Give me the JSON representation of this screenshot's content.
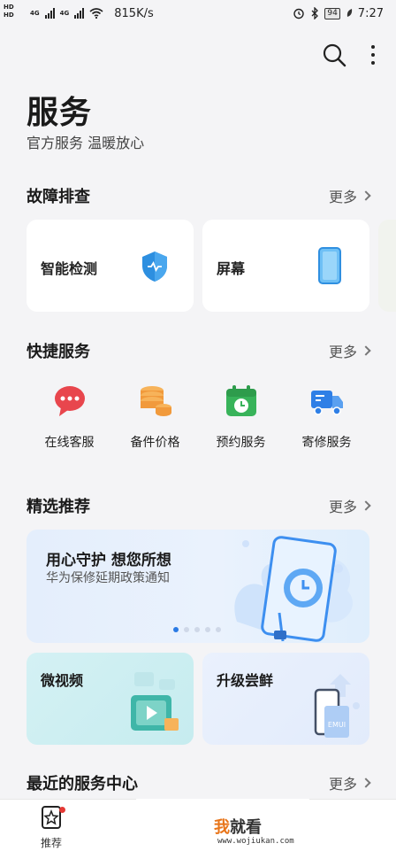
{
  "status_bar": {
    "hd_top": "HD",
    "hd_bottom": "HD",
    "net1": "4G",
    "net2": "4G",
    "speed": "815K/s",
    "battery": "94",
    "time": "7:27"
  },
  "header": {
    "title": "服务",
    "subtitle": "官方服务 温暖放心"
  },
  "sections": {
    "troubleshoot": {
      "title": "故障排查",
      "more": "更多"
    },
    "quick": {
      "title": "快捷服务",
      "more": "更多"
    },
    "featured": {
      "title": "精选推荐",
      "more": "更多"
    },
    "nearby": {
      "title": "最近的服务中心",
      "more": "更多"
    }
  },
  "troubleshoot_cards": [
    {
      "label": "智能检测",
      "icon": "shield-icon"
    },
    {
      "label": "屏幕",
      "icon": "phone-icon"
    }
  ],
  "quick_services": [
    {
      "label": "在线客服",
      "icon": "chat-bubble-icon"
    },
    {
      "label": "备件价格",
      "icon": "coins-icon"
    },
    {
      "label": "预约服务",
      "icon": "calendar-clock-icon"
    },
    {
      "label": "寄修服务",
      "icon": "truck-icon"
    }
  ],
  "banner": {
    "title": "用心守护 想您所想",
    "subtitle": "华为保修延期政策通知"
  },
  "features": [
    {
      "label": "微视频",
      "icon": "video-icon"
    },
    {
      "label": "升级尝鲜",
      "icon": "phone-upgrade-icon",
      "icon_text": "EMUI"
    }
  ],
  "bottom_nav": {
    "label": "推荐"
  },
  "watermark": {
    "main_a": "我",
    "main_b": "就看",
    "sub": "www.wojiukan.com"
  },
  "colors": {
    "accent": "#2a7ae4",
    "chat_red": "#e8464d",
    "coin_orange": "#f19a3c",
    "calendar_green": "#38b35a",
    "truck_blue": "#2f7fe6"
  }
}
